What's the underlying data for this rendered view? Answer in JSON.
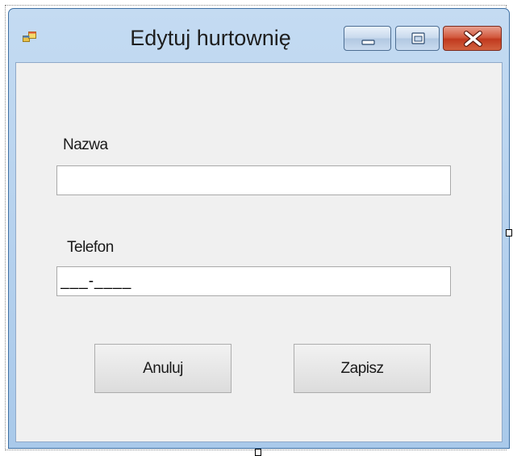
{
  "window": {
    "title": "Edytuj hurtownię",
    "icon": "windows-form-icon",
    "controls": {
      "minimize": "minimize-icon",
      "maximize": "maximize-icon",
      "close": "close-icon"
    }
  },
  "form": {
    "nazwa": {
      "label": "Nazwa",
      "value": ""
    },
    "telefon": {
      "label": "Telefon",
      "value": "___-____"
    },
    "buttons": {
      "cancel_label": "Anuluj",
      "save_label": "Zapisz"
    }
  },
  "colors": {
    "titlebar": "#b9d3ee",
    "client": "#f0f0f0",
    "close_button": "#c7452a",
    "border": "#3d6fa3"
  }
}
